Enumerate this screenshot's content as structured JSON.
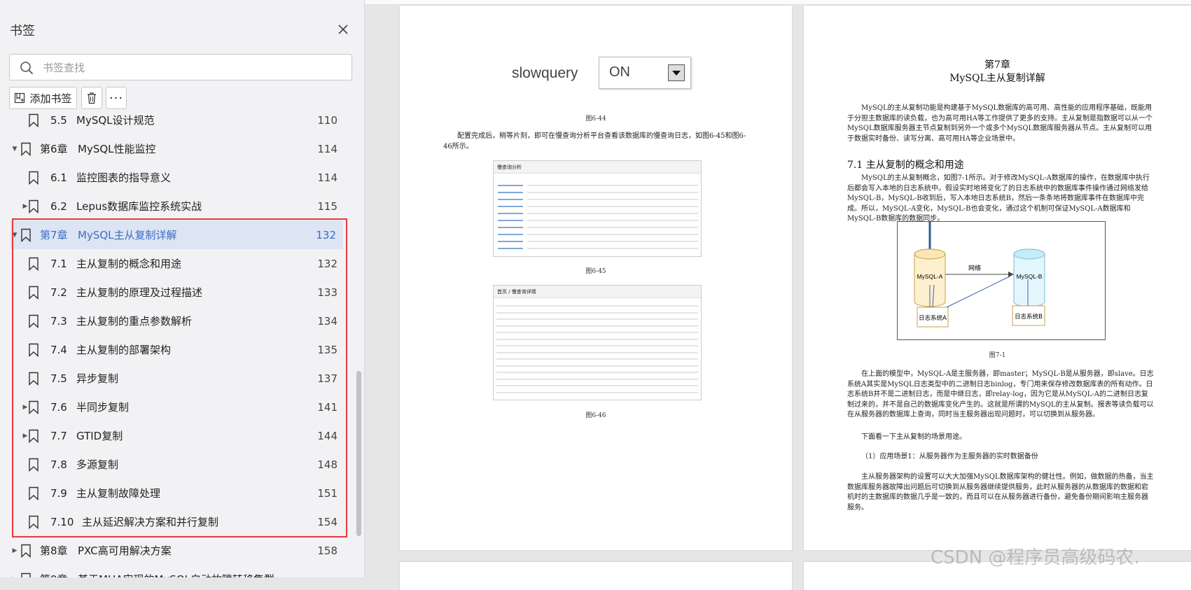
{
  "sidebar": {
    "title": "书签",
    "search_placeholder": "书签查找",
    "add_bookmark_label": "添加书签",
    "more_label": "···",
    "items": [
      {
        "num": "5.5",
        "text": "MySQL设计规范",
        "page": "110",
        "level": 1,
        "arrow": "",
        "partial": true
      },
      {
        "num": "第6章",
        "text": "MySQL性能监控",
        "page": "114",
        "level": 0,
        "arrow": "down"
      },
      {
        "num": "6.1",
        "text": "监控图表的指导意义",
        "page": "114",
        "level": 1,
        "arrow": ""
      },
      {
        "num": "6.2",
        "text": "Lepus数据库监控系统实战",
        "page": "115",
        "level": 1,
        "arrow": "right"
      },
      {
        "num": "第7章",
        "text": "MySQL主从复制详解",
        "page": "132",
        "level": 0,
        "arrow": "down",
        "selected": true
      },
      {
        "num": "7.1",
        "text": "主从复制的概念和用途",
        "page": "132",
        "level": 1,
        "arrow": ""
      },
      {
        "num": "7.2",
        "text": "主从复制的原理及过程描述",
        "page": "133",
        "level": 1,
        "arrow": ""
      },
      {
        "num": "7.3",
        "text": "主从复制的重点参数解析",
        "page": "134",
        "level": 1,
        "arrow": ""
      },
      {
        "num": "7.4",
        "text": "主从复制的部署架构",
        "page": "135",
        "level": 1,
        "arrow": ""
      },
      {
        "num": "7.5",
        "text": "异步复制",
        "page": "137",
        "level": 1,
        "arrow": ""
      },
      {
        "num": "7.6",
        "text": "半同步复制",
        "page": "141",
        "level": 1,
        "arrow": "right"
      },
      {
        "num": "7.7",
        "text": "GTID复制",
        "page": "144",
        "level": 1,
        "arrow": "right"
      },
      {
        "num": "7.8",
        "text": "多源复制",
        "page": "148",
        "level": 1,
        "arrow": ""
      },
      {
        "num": "7.9",
        "text": "主从复制故障处理",
        "page": "151",
        "level": 1,
        "arrow": ""
      },
      {
        "num": "7.10",
        "text": "主从延迟解决方案和并行复制",
        "page": "154",
        "level": 1,
        "arrow": ""
      },
      {
        "num": "第8章",
        "text": "PXC高可用解决方案",
        "page": "158",
        "level": 0,
        "arrow": "right"
      },
      {
        "num": "第9章",
        "text": "基于MHA实现的MySQL自动故障转移集群",
        "page": "",
        "level": 0,
        "arrow": "right",
        "partial": true
      }
    ]
  },
  "left_page": {
    "slowquery_label": "slowquery",
    "slowquery_value": "ON",
    "fig_6_44": "图6-44",
    "paragraph": "配置完成后，稍等片刻，即可在慢查询分析平台查看该数据库的慢查询日志，如图6-45和图6-46所示。",
    "fig_6_45": "图6-45",
    "fig_6_46": "图6-46",
    "shot1_title": "慢查询分析",
    "shot2_title": "首页 / 慢查询详情"
  },
  "right_page": {
    "chapter_num": "第7章",
    "chapter_title": "MySQL主从复制详解",
    "intro": "MySQL的主从复制功能是构建基于MySQL数据库的高可用、高性能的应用程序基础，既能用于分担主数据库的读负载，也为高可用HA等工作提供了更多的支持。主从复制是指数据可以从一个MySQL数据库服务器主节点复制到另外一个或多个MySQL数据库服务器从节点。主从复制可以用于数据实时备份、读写分离、高可用HA等企业场景中。",
    "section_title": "7.1  主从复制的概念和用途",
    "section_para": "MySQL的主从复制概念，如图7-1所示。对于修改MySQL-A数据库的操作，在数据库中执行后都会写入本地的日志系统中。假设实时地将变化了的日志系统中的数据库事件操作通过网络发给MySQL-B，MySQL-B收到后，写入本地日志系统B，然后一条条地将数据库事件在数据库中完成。所以，MySQL-A变化，MySQL-B也会变化，通过这个机制可保证MySQL-A数据库和MySQL-B数据库的数据同步。",
    "diagram": {
      "node_a": "MySQL-A",
      "node_b": "MySQL-B",
      "network": "网络",
      "log_a": "日志系统A",
      "log_b": "日志系统B"
    },
    "fig_7_1": "图7-1",
    "model_para": "在上面的模型中，MySQL-A是主服务器，即master；MySQL-B是从服务器，即slave。日志系统A其实是MySQL日志类型中的二进制日志binlog，专门用来保存修改数据库表的所有动作。日志系统B并不是二进制日志，而是中继日志，即relay-log，因为它是从MySQL-A的二进制日志复制过来的，并不是自己的数据库变化产生的。这就是所谓的MySQL的主从复制。报表等读负载可以在从服务器的数据库上查询，同时当主服务器出现问题时，可以切换到从服务器。",
    "usage_intro": "下面看一下主从复制的场景用途。",
    "scenario_title": "（1）应用场景1：从服务器作为主服务器的实时数据备份",
    "scenario_para": "主从服务器架构的设置可以大大加强MySQL数据库架构的健壮性。例如，做数据的热备，当主数据库服务器故障出问题后可切换到从服务器继续提供服务，此时从服务器的从数据库的数据和宕机时的主数据库的数据几乎是一致的，而且可以在从服务器进行备份，避免备份期间影响主服务器服务。"
  },
  "watermark": "CSDN @程序员高级码农.",
  "colors": {
    "selected_bg": "#dde4f3",
    "selected_text": "#3a6fc4",
    "highlight_border": "#e8383d"
  }
}
